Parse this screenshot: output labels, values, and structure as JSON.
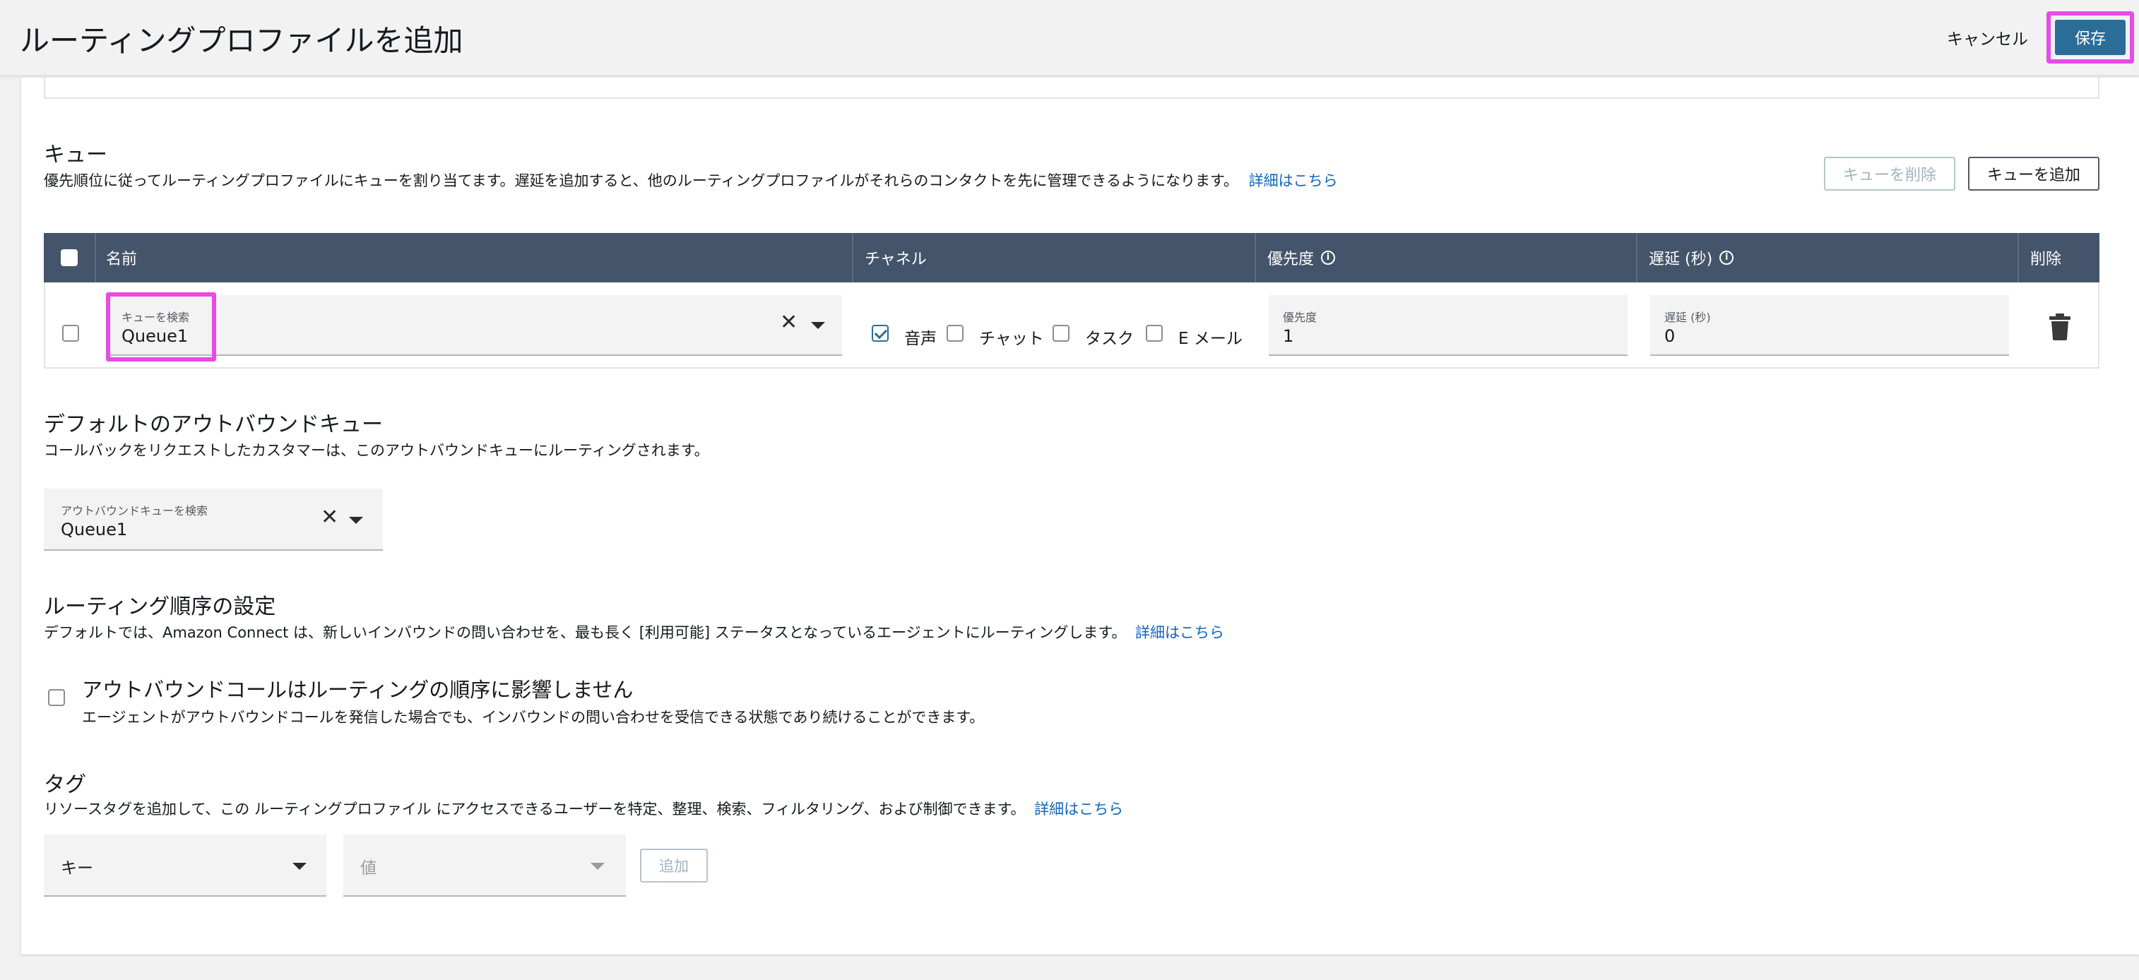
{
  "header": {
    "title": "ルーティングプロファイルを追加",
    "cancel_label": "キャンセル",
    "save_label": "保存"
  },
  "queues": {
    "title": "キュー",
    "description": "優先順位に従ってルーティングプロファイルにキューを割り当てます。遅延を追加すると、他のルーティングプロファイルがそれらのコンタクトを先に管理できるようになります。",
    "learn_more": "詳細はこちら",
    "remove_button": "キューを削除",
    "add_button": "キューを追加",
    "columns": {
      "name": "名前",
      "channel": "チャネル",
      "priority": "優先度",
      "delay": "遅延 (秒)",
      "delete": "削除"
    },
    "row": {
      "queue_label": "キューを検索",
      "queue_value": "Queue1",
      "channels": [
        {
          "label": "音声",
          "checked": true
        },
        {
          "label": "チャット",
          "checked": false
        },
        {
          "label": "タスク",
          "checked": false
        },
        {
          "label": "E メール",
          "checked": false
        }
      ],
      "priority_label": "優先度",
      "priority_value": "1",
      "delay_label": "遅延 (秒)",
      "delay_value": "0"
    }
  },
  "outbound": {
    "title": "デフォルトのアウトバウンドキュー",
    "description": "コールバックをリクエストしたカスタマーは、このアウトバウンドキューにルーティングされます。",
    "field_label": "アウトバウンドキューを検索",
    "field_value": "Queue1"
  },
  "routing_order": {
    "title": "ルーティング順序の設定",
    "description": "デフォルトでは、Amazon Connect は、新しいインバウンドの問い合わせを、最も長く [利用可能] ステータスとなっているエージェントにルーティングします。",
    "learn_more": "詳細はこちら",
    "option_title": "アウトバウンドコールはルーティングの順序に影響しません",
    "option_description": "エージェントがアウトバウンドコールを発信した場合でも、インバウンドの問い合わせを受信できる状態であり続けることができます。",
    "option_checked": false
  },
  "tags": {
    "title": "タグ",
    "description": "リソースタグを追加して、この ルーティングプロファイル にアクセスできるユーザーを特定、整理、検索、フィルタリング、および制御できます。",
    "learn_more": "詳細はこちら",
    "key_placeholder": "キー",
    "value_placeholder": "値",
    "add_button": "追加"
  },
  "colors": {
    "primary": "#2b6d99",
    "table_header": "#44546a",
    "highlight": "#e64be6",
    "link": "#1166bb"
  }
}
